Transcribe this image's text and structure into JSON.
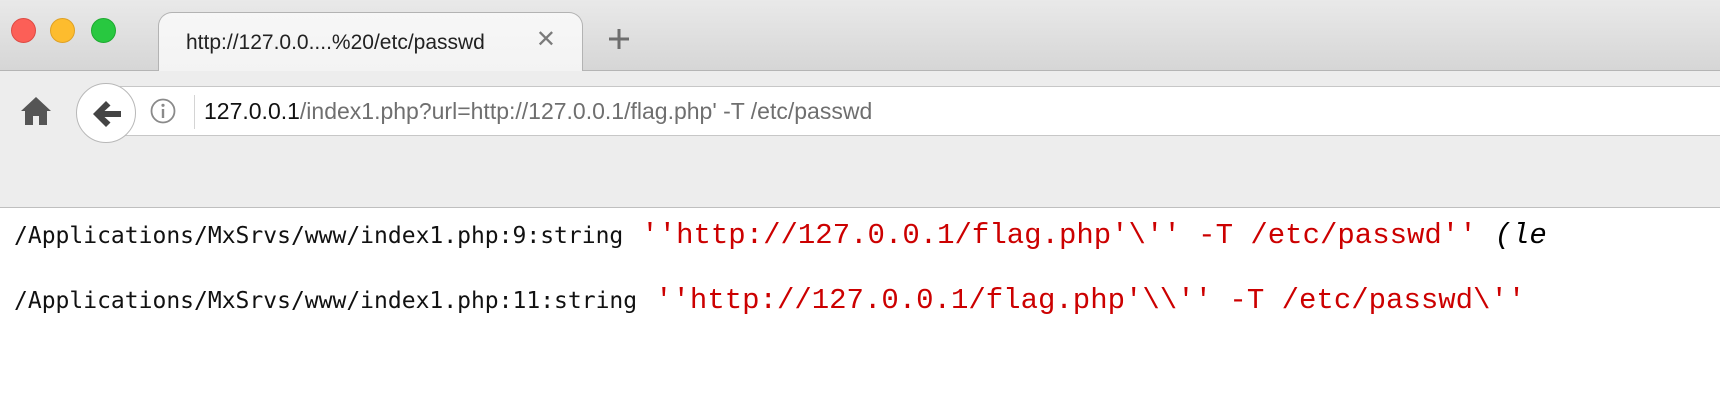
{
  "tab": {
    "title": "http://127.0.0....%20/etc/passwd",
    "close_glyph": "✕"
  },
  "navbar": {
    "url_host": "127.0.0.1",
    "url_path": "/index1.php?url=http://127.0.0.1/flag.php' -T /etc/passwd"
  },
  "icons": {
    "close_window": "close-window-icon",
    "minimize_window": "minimize-window-icon",
    "maximize_window": "maximize-window-icon",
    "new_tab": "plus-icon",
    "home": "home-icon",
    "back": "back-arrow-icon",
    "site_info": "info-icon"
  },
  "colors": {
    "string_value": "#cc0000",
    "traffic_close": "#fc5f57",
    "traffic_min": "#fdbc2e",
    "traffic_max": "#28c840"
  },
  "output": [
    {
      "location": "/Applications/MxSrvs/www/index1.php:9:string",
      "value": "''http://127.0.0.1/flag.php'\\'' -T /etc/passwd''",
      "suffix": "(le"
    },
    {
      "location": "/Applications/MxSrvs/www/index1.php:11:string",
      "value": "''http://127.0.0.1/flag.php'\\\\'' -T /etc/passwd\\''",
      "suffix": ""
    }
  ]
}
